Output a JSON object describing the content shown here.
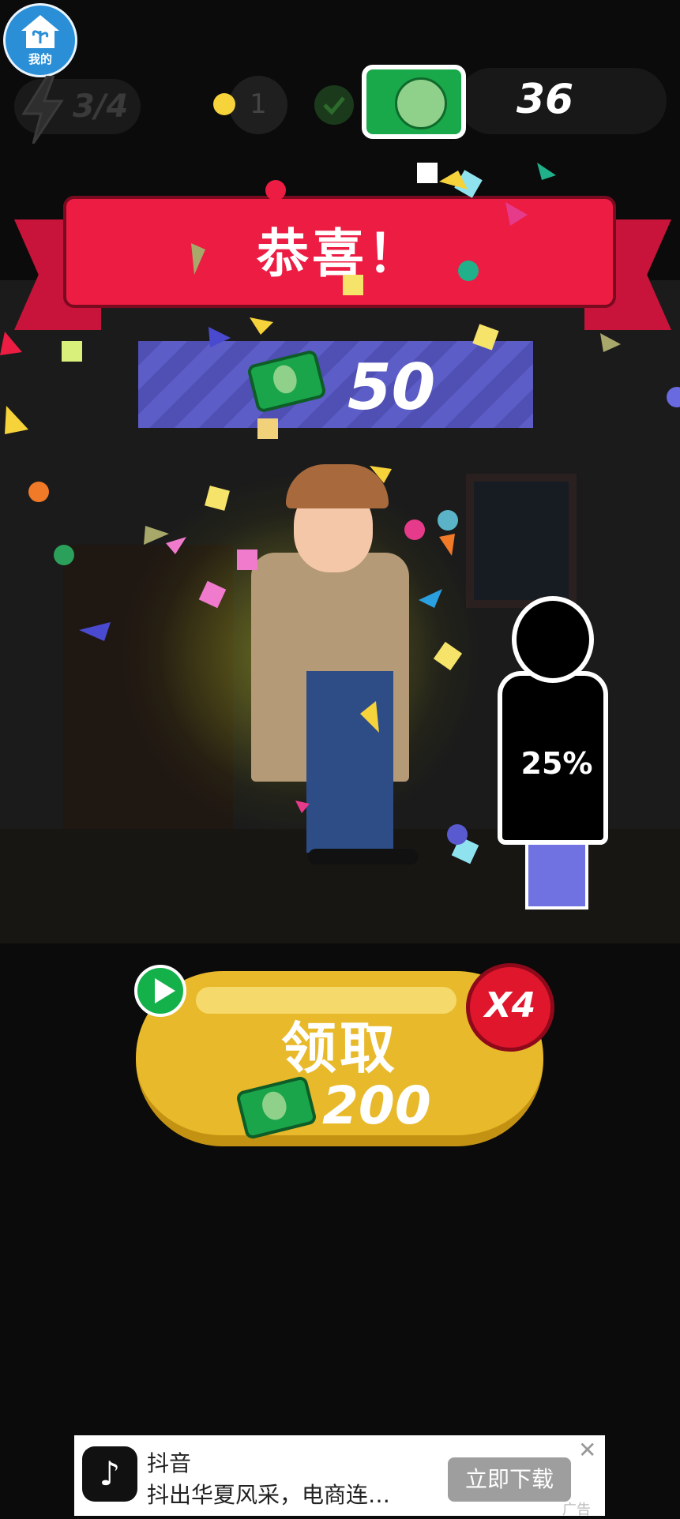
{
  "home_badge": {
    "label": "我的"
  },
  "hud": {
    "energy": "3/4",
    "level": "1",
    "cash": "36"
  },
  "banner": {
    "title": "恭喜！"
  },
  "reward": {
    "amount": "50"
  },
  "collection": {
    "progress": "25%"
  },
  "claim": {
    "label": "领取",
    "amount": "200",
    "multiplier": "X4"
  },
  "ad": {
    "app_name": "抖音",
    "description": "抖出华夏风采，电商连…",
    "button": "立即下载",
    "tag": "广告"
  }
}
